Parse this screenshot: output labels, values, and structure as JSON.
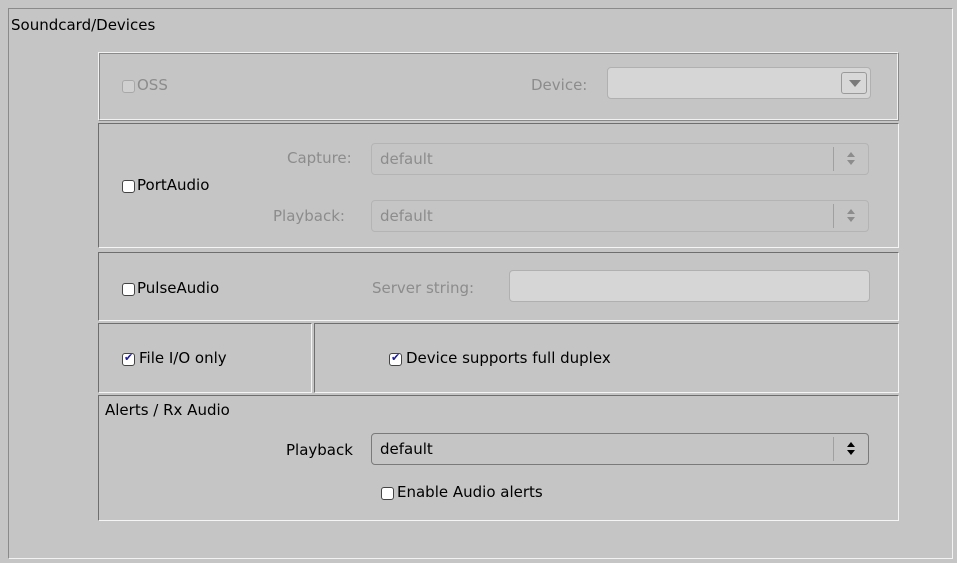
{
  "section_title": "Soundcard/Devices",
  "oss": {
    "label": "OSS",
    "checked": false,
    "enabled": false,
    "device_label": "Device:",
    "device_value": ""
  },
  "portaudio": {
    "label": "PortAudio",
    "checked": false,
    "capture_label": "Capture:",
    "capture_value": "default",
    "playback_label": "Playback:",
    "playback_value": "default"
  },
  "pulseaudio": {
    "label": "PulseAudio",
    "checked": false,
    "server_label": "Server string:",
    "server_value": ""
  },
  "file_io": {
    "label": "File I/O only",
    "checked": true
  },
  "full_duplex": {
    "label": "Device supports full duplex",
    "checked": true
  },
  "alerts": {
    "title": "Alerts / Rx Audio",
    "playback_label": "Playback",
    "playback_value": "default",
    "enable_label": "Enable Audio alerts",
    "enable_checked": false
  },
  "icons": {
    "check_mark": "✔",
    "dropdown": "triangle-down-icon",
    "spinner": "up-down-arrows-icon"
  }
}
